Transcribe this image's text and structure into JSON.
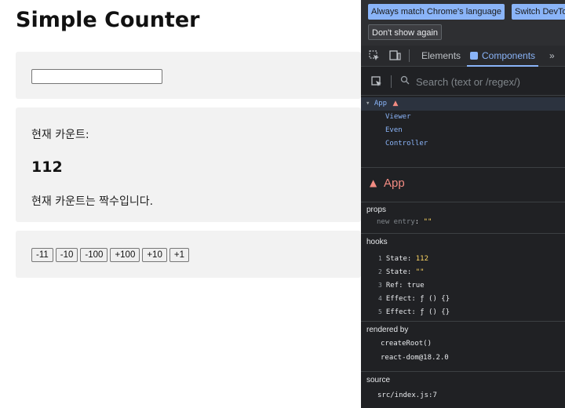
{
  "app": {
    "title": "Simple Counter",
    "input_value": "",
    "viewer": {
      "label": "현재 카운트:",
      "count": "112",
      "parity_text": "현재 카운트는 짝수입니다."
    },
    "buttons": [
      "-11",
      "-10",
      "-100",
      "+100",
      "+10",
      "+1"
    ]
  },
  "devtools": {
    "infobar": {
      "match_language": "Always match Chrome's language",
      "switch": "Switch DevTo",
      "dont_show": "Don't show again"
    },
    "tabs": {
      "elements": "Elements",
      "components": "Components",
      "more": "»"
    },
    "search_placeholder": "Search (text or /regex/)",
    "tree": {
      "app": "App",
      "viewer": "Viewer",
      "even": "Even",
      "controller": "Controller"
    },
    "selected_component": "App",
    "props": {
      "title": "props",
      "key": "new entry",
      "value": "\"\""
    },
    "hooks": {
      "title": "hooks",
      "items": [
        {
          "index": "1",
          "label": "State:",
          "value": "112"
        },
        {
          "index": "2",
          "label": "State:",
          "value": "\"\""
        },
        {
          "index": "3",
          "label": "Ref:",
          "value": "true"
        },
        {
          "index": "4",
          "label": "Effect:",
          "value": "ƒ () {}"
        },
        {
          "index": "5",
          "label": "Effect:",
          "value": "ƒ () {}"
        }
      ]
    },
    "rendered_by": {
      "title": "rendered by",
      "items": [
        "createRoot()",
        "react-dom@18.2.0"
      ]
    },
    "source": {
      "title": "source",
      "file": "src/index.js:7"
    },
    "colors": {
      "accent": "#8ab4f8",
      "warning": "#f28b82",
      "value": "#fdd663",
      "panel_bg": "#202124"
    }
  }
}
